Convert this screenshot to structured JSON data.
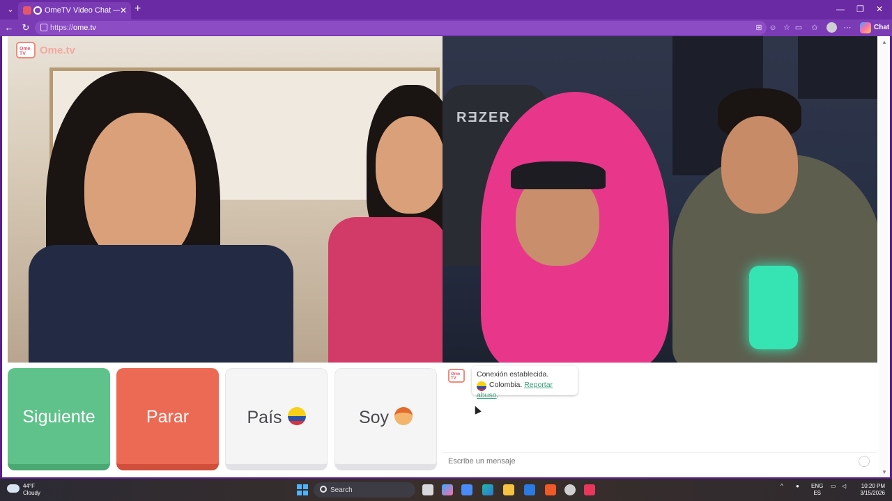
{
  "browser": {
    "tab_title": "OmeTV Video Chat — Omegl",
    "tab_close": "✕",
    "new_tab": "+",
    "url_scheme": "https://",
    "url_host": "ome.tv",
    "chat_label": "Chat",
    "window_controls": [
      "—",
      "❐",
      "✕"
    ]
  },
  "site": {
    "logo_badge": "Ome TV",
    "logo_name": "Ome.tv"
  },
  "remote_video": {
    "chair_brand": "RƎZER"
  },
  "controls": {
    "next_label": "Siguiente",
    "stop_label": "Parar",
    "country_label": "País",
    "country_flag": "colombia-flag-icon",
    "gender_label": "Soy",
    "gender_icon": "boy-emoji-icon"
  },
  "chat": {
    "status_line": "Conexión establecida.",
    "country": "Colombia.",
    "report_link": "Reportar abuso",
    "report_suffix": ".",
    "input_placeholder": "Escribe un mensaje"
  },
  "taskbar": {
    "temperature": "44°F",
    "condition": "Cloudy",
    "search_label": "Search",
    "language_top": "ENG",
    "language_bottom": "ES",
    "time": "10:20 PM",
    "date": "3/15/2026"
  },
  "colors": {
    "next": "#5fc28a",
    "stop": "#ec6a54",
    "browser_frame": "#6a2aa3",
    "link": "#3aa07a"
  }
}
